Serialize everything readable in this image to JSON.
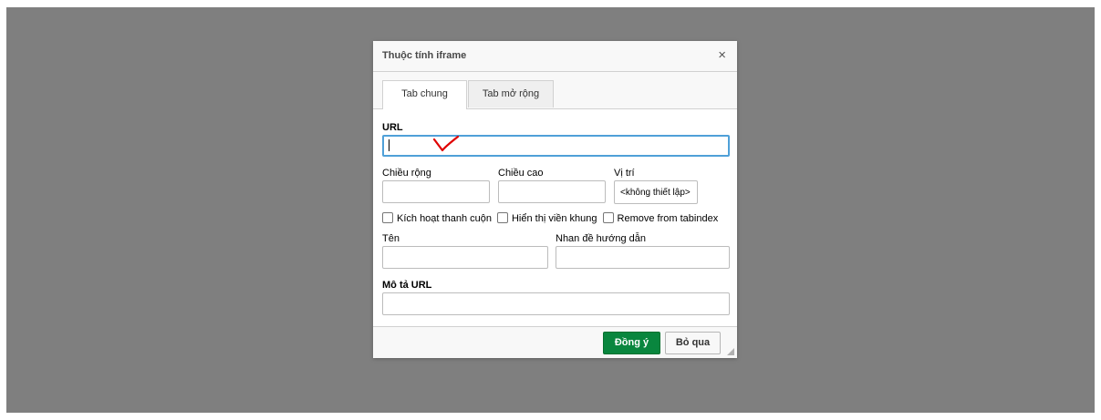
{
  "dialog": {
    "title": "Thuộc tính iframe",
    "close_symbol": "×"
  },
  "tabs": [
    {
      "label": "Tab chung",
      "active": true
    },
    {
      "label": "Tab mở rộng",
      "active": false
    }
  ],
  "form": {
    "url_label": "URL",
    "url_value": "",
    "width_label": "Chiều rộng",
    "height_label": "Chiều cao",
    "position_label": "Vị trí",
    "position_value": "<không thiết lập>",
    "checkboxes": [
      {
        "label": "Kích hoạt thanh cuộn",
        "checked": false
      },
      {
        "label": "Hiển thị viền khung",
        "checked": false
      },
      {
        "label": "Remove from tabindex",
        "checked": false
      }
    ],
    "name_label": "Tên",
    "advisory_title_label": "Nhan đề hướng dẫn",
    "long_desc_label": "Mô tả URL"
  },
  "footer": {
    "ok_label": "Đồng ý",
    "cancel_label": "Bỏ qua"
  },
  "colors": {
    "overlay": "#7f7f7f",
    "ok_button": "#09863e",
    "focus_border": "#4fa0d8",
    "annotation": "#e00000"
  }
}
